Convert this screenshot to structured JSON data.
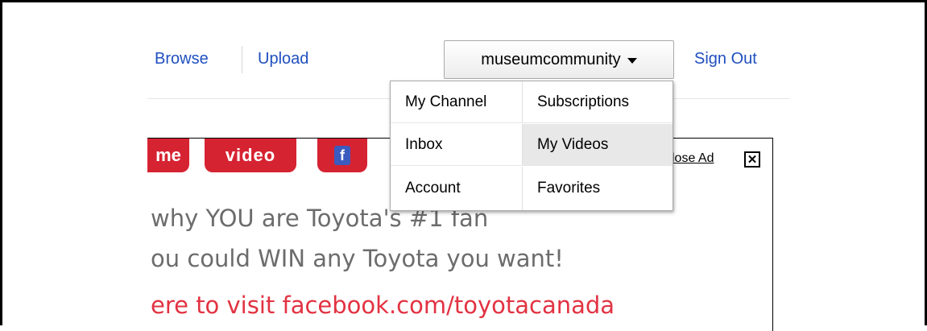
{
  "nav": {
    "browse": "Browse",
    "upload": "Upload",
    "user": "museumcommunity",
    "signout": "Sign Out"
  },
  "user_menu": {
    "items": [
      "My Channel",
      "Subscriptions",
      "Inbox",
      "My Videos",
      "Account",
      "Favorites"
    ],
    "highlighted": "My Videos"
  },
  "ad": {
    "pill_home": "me",
    "pill_video": "video",
    "pill_fb": "f",
    "close_label": "lose Ad",
    "close_icon": "close-x-icon",
    "line1": "why YOU are Toyota's #1 fan",
    "line2": "ou could WIN any Toyota you want!",
    "line3": "ere to visit facebook.com/toyotacanada",
    "brand_color": "#d62332",
    "link_color": "#1f4fbf"
  }
}
